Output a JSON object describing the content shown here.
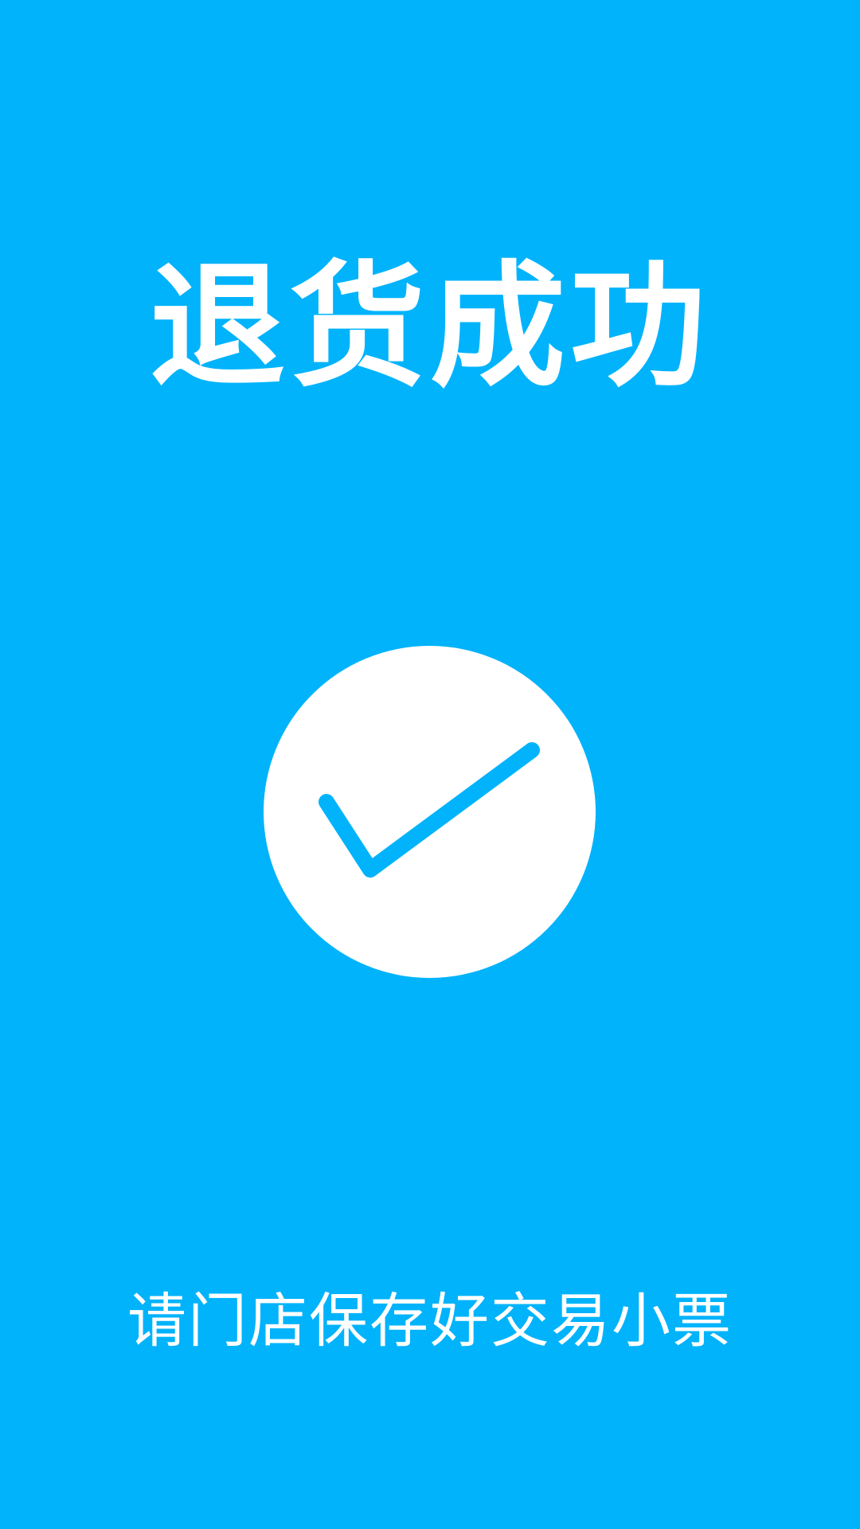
{
  "screen": {
    "title": "退货成功",
    "message": "请门店保存好交易小票",
    "icon": "checkmark-icon",
    "colors": {
      "background": "#00b3fb",
      "foreground": "#ffffff",
      "check": "#00b3fb"
    }
  }
}
